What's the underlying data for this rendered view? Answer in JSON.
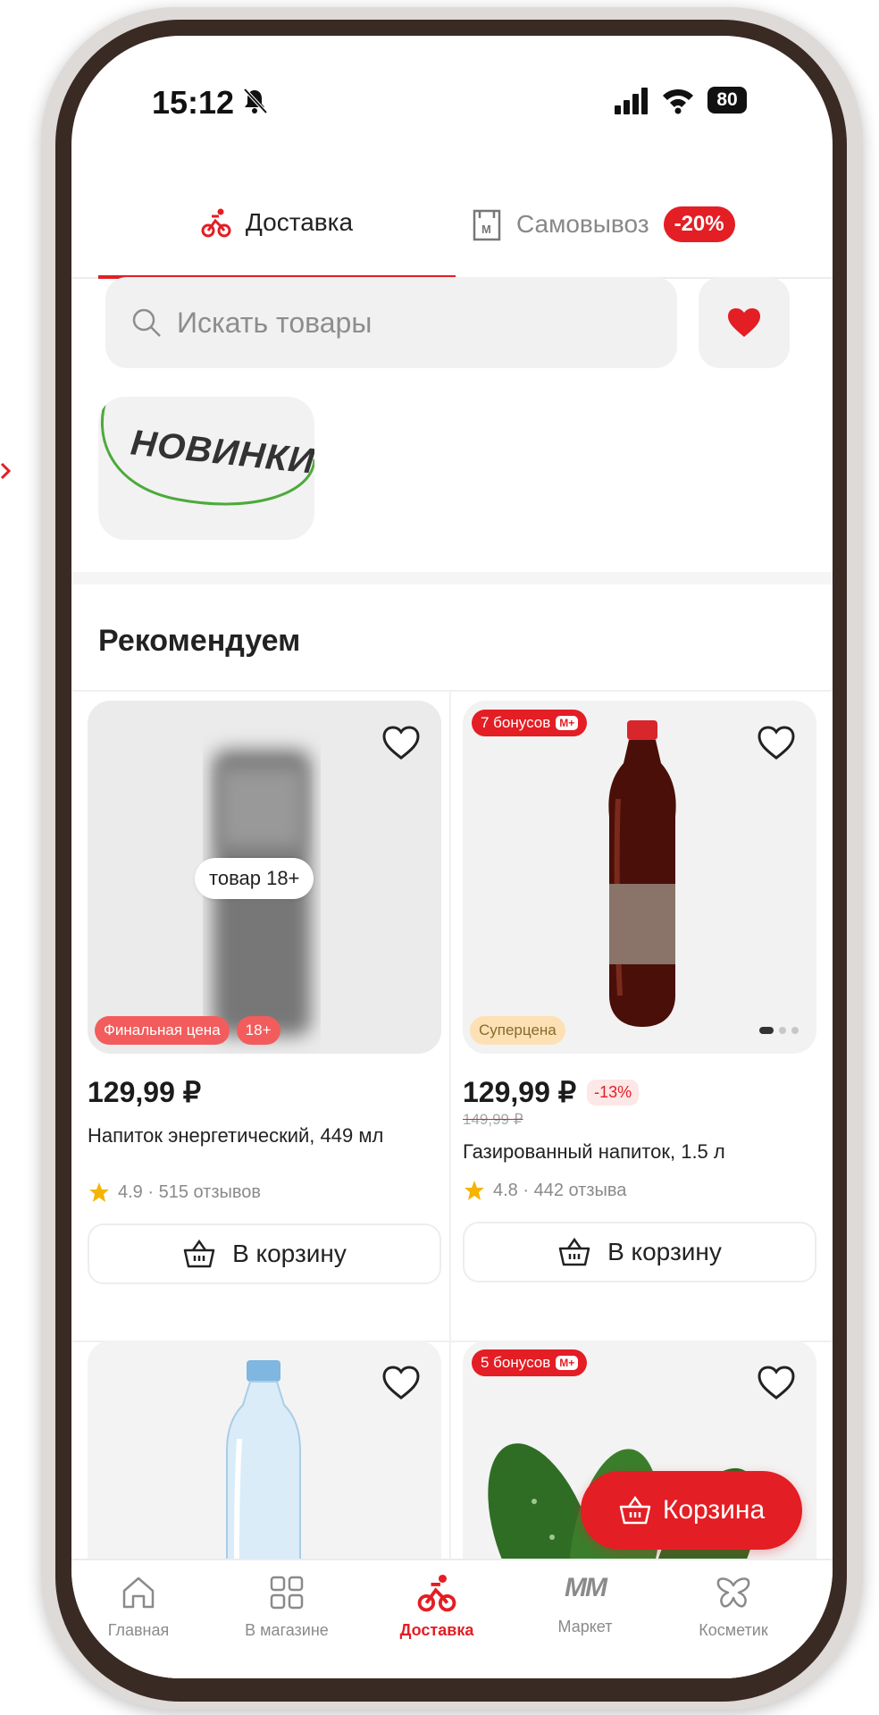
{
  "status_bar": {
    "time": "15:12",
    "battery": "80"
  },
  "tabs": [
    {
      "label": "Доставка",
      "icon": "bike-icon",
      "active": true
    },
    {
      "label": "Самовывоз",
      "icon": "bag-icon",
      "badge": "-20%"
    }
  ],
  "search": {
    "placeholder": "Искать товары"
  },
  "story": {
    "label": "НОВИНКИ"
  },
  "section": {
    "title": "Рекомендуем"
  },
  "products": [
    {
      "age_overlay": "товар 18+",
      "tags": [
        "Финальная цена",
        "18+"
      ],
      "price": "129,99 ₽",
      "name": "Напиток энергетический, 449 мл",
      "rating": "4.9 · 515 отзывов",
      "cart_label": "В корзину"
    },
    {
      "bonus": "7 бонусов",
      "bonus_mark": "M+",
      "tags": [
        "Суперцена"
      ],
      "price": "129,99 ₽",
      "discount": "-13%",
      "old_price": "149,99 ₽",
      "name": "Газированный напиток, 1.5 л",
      "rating": "4.8 · 442 отзыва",
      "cart_label": "В корзину"
    },
    {
      "name": ""
    },
    {
      "bonus": "5 бонусов",
      "bonus_mark": "M+"
    }
  ],
  "floating_cart": {
    "label": "Корзина"
  },
  "bottom_nav": [
    {
      "label": "Главная",
      "icon": "home-icon"
    },
    {
      "label": "В магазине",
      "icon": "grid-icon"
    },
    {
      "label": "Доставка",
      "icon": "bike-icon",
      "active": true
    },
    {
      "label": "Маркет",
      "icon": "market-logo",
      "logo_text": "MM"
    },
    {
      "label": "Косметик",
      "icon": "butterfly-icon"
    }
  ],
  "colors": {
    "accent": "#e31e24",
    "bezel": "#3a2a24",
    "background": "#ffffff"
  }
}
